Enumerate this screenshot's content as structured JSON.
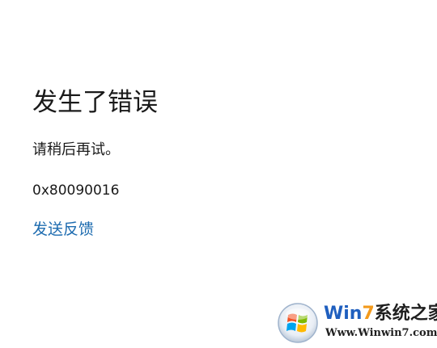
{
  "error": {
    "title": "发生了错误",
    "message": "请稍后再试。",
    "code": "0x80090016",
    "feedback_link": "发送反馈"
  },
  "watermark": {
    "name_blue": "Win",
    "name_orange": "7",
    "name_rest": "系统之家",
    "url": "Www.Winwin7.com",
    "colors": {
      "blue": "#1f5fbf",
      "orange": "#f39a1c"
    }
  },
  "colors": {
    "background": "#ffffff",
    "text": "#1a1a1a",
    "link": "#1e6cb0"
  }
}
